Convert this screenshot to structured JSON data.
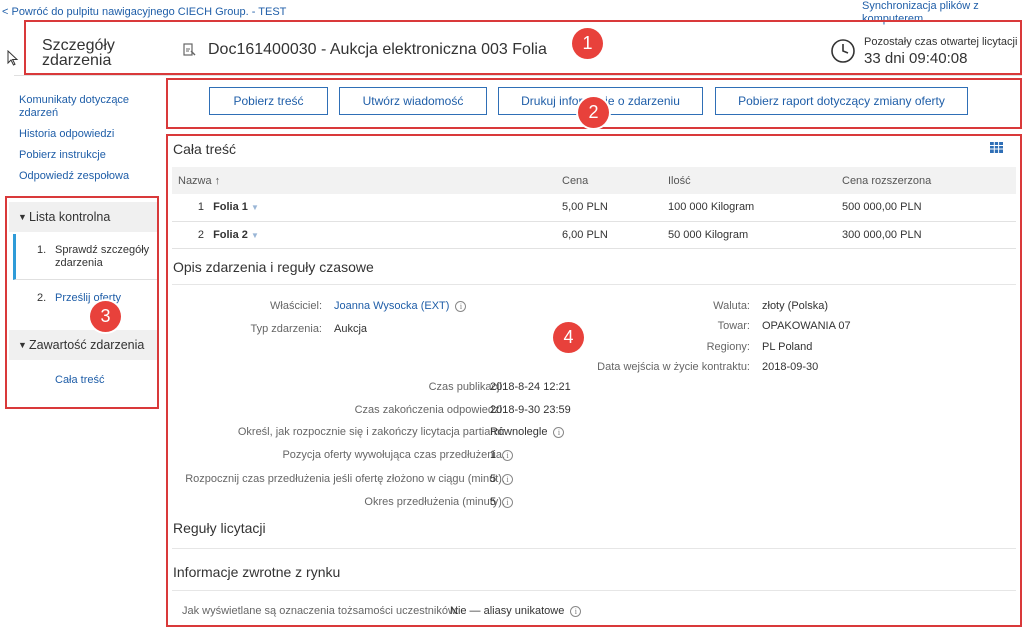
{
  "top": {
    "back_link": "< Powróć do pulpitu nawigacyjnego CIECH Group. - TEST",
    "sync_link": "Synchronizacja plików z komputerem"
  },
  "header": {
    "title_line1": "Szczegóły",
    "title_line2": "zdarzenia",
    "doc_title": "Doc161400030 - Aukcja elektroniczna 003 Folia",
    "time_label": "Pozostały czas otwartej licytacji",
    "time_value": "33 dni 09:40:08"
  },
  "actions": {
    "download_content": "Pobierz treść",
    "create_message": "Utwórz wiadomość",
    "print_info": "Drukuj informacje o zdarzeniu",
    "download_report": "Pobierz raport dotyczący zmiany oferty"
  },
  "sidebar": {
    "links": [
      "Komunikaty dotyczące zdarzeń",
      "Historia odpowiedzi",
      "Pobierz instrukcje",
      "Odpowiedź zespołowa"
    ],
    "checklist_title": "Lista kontrolna",
    "steps": [
      {
        "num": "1.",
        "label": "Sprawdź szczegóły zdarzenia"
      },
      {
        "num": "2.",
        "label": "Prześlij oferty"
      }
    ],
    "contents_title": "Zawartość zdarzenia",
    "contents_item": "Cała treść"
  },
  "callouts": [
    "1",
    "2",
    "3",
    "4"
  ],
  "main": {
    "title": "Cała treść",
    "table": {
      "headers": [
        "Nazwa ↑",
        "Cena",
        "Ilość",
        "Cena rozszerzona"
      ],
      "rows": [
        {
          "no": "1",
          "name": "Folia 1",
          "price": "5,00 PLN",
          "qty": "100 000 Kilogram",
          "ext": "500 000,00 PLN"
        },
        {
          "no": "2",
          "name": "Folia 2",
          "price": "6,00 PLN",
          "qty": "50 000 Kilogram",
          "ext": "300 000,00 PLN"
        }
      ]
    },
    "desc_title": "Opis zdarzenia i reguły czasowe",
    "owner_label": "Właściciel:",
    "owner_value": "Joanna Wysocka (EXT)",
    "type_label": "Typ zdarzenia:",
    "type_value": "Aukcja",
    "currency_label": "Waluta:",
    "currency_value": "złoty (Polska)",
    "commodity_label": "Towar:",
    "commodity_value": "OPAKOWANIA 07",
    "regions_label": "Regiony:",
    "regions_value": "PL Poland",
    "effective_label": "Data wejścia w życie kontraktu:",
    "effective_value": "2018-09-30",
    "pub_label": "Czas publikacji:",
    "pub_value": "2018-8-24 12:21",
    "close_label": "Czas zakończenia odpowiedzi:",
    "close_value": "2018-9-30 23:59",
    "lot_label": "Określ, jak rozpocznie się i zakończy licytacja partiami:",
    "lot_value": "Równolegle",
    "rank_label": "Pozycja oferty wywołująca czas przedłużenia:",
    "rank_value": "1",
    "start_label": "Rozpocznij czas przedłużenia jeśli ofertę złożono w ciągu (minut):",
    "start_value": "5",
    "period_label": "Okres przedłużenia (minuty):",
    "period_value": "5",
    "bidding_rules": "Reguły licytacji",
    "feedback_title": "Informacje zwrotne z rynku",
    "identity_label": "Jak wyświetlane są oznaczenia tożsamości uczestników:",
    "identity_value": "Nie — aliasy unikatowe"
  }
}
